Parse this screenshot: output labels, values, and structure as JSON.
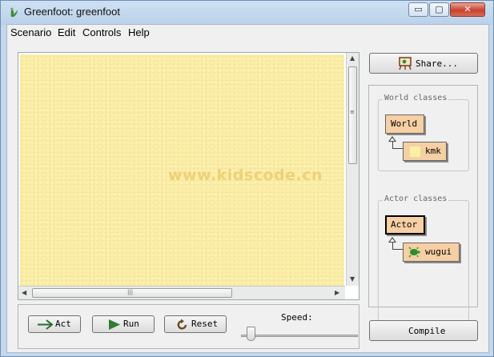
{
  "window": {
    "title": "Greenfoot: greenfoot",
    "minimize_glyph": "▭",
    "maximize_glyph": "▢",
    "close_glyph": "✕"
  },
  "menubar": {
    "items": [
      "Scenario",
      "Edit",
      "Controls",
      "Help"
    ]
  },
  "world": {
    "watermark": "www.kidscode.cn",
    "background_color": "#fbeea6"
  },
  "controls": {
    "act_label": "Act",
    "run_label": "Run",
    "reset_label": "Reset",
    "speed_label": "Speed:",
    "speed_value": 0.05
  },
  "sidebar": {
    "share_label": "Share...",
    "world_classes_title": "World classes",
    "world_classes": [
      {
        "name": "World",
        "icon": "none"
      },
      {
        "name": "kmk",
        "icon": "yellow-swatch"
      }
    ],
    "actor_classes_title": "Actor classes",
    "actor_classes": [
      {
        "name": "Actor",
        "icon": "none"
      },
      {
        "name": "wugui",
        "icon": "turtle"
      }
    ],
    "compile_label": "Compile"
  },
  "colors": {
    "class_fill": "#f6cfa4",
    "title_gradient_top": "#cfe0f3",
    "close_button": "#c8412e"
  }
}
